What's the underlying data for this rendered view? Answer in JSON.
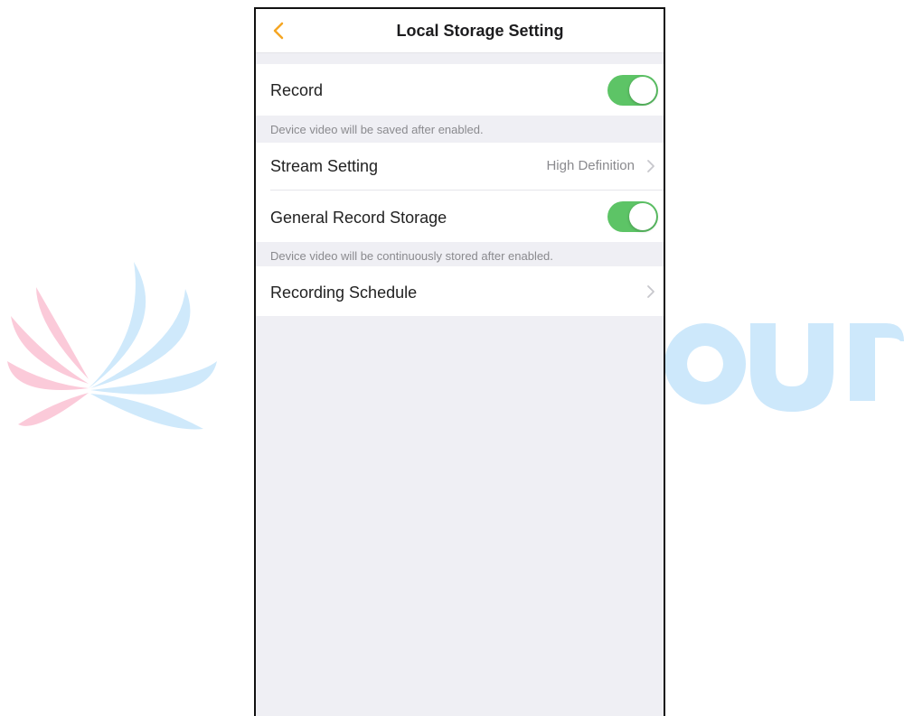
{
  "navbar": {
    "title": "Local Storage Setting",
    "back_icon": "chevron-left-icon",
    "accent_color": "#f5a623"
  },
  "settings": {
    "record": {
      "label": "Record",
      "enabled": true
    },
    "record_note": "Device video will be saved after enabled.",
    "stream_setting": {
      "label": "Stream Setting",
      "value": "High Definition"
    },
    "general_record_storage": {
      "label": "General Record Storage",
      "enabled": true
    },
    "general_note": "Device video will be continuously stored after enabled.",
    "recording_schedule": {
      "label": "Recording Schedule"
    }
  },
  "colors": {
    "toggle_on": "#5dc466",
    "background": "#efeff4"
  }
}
